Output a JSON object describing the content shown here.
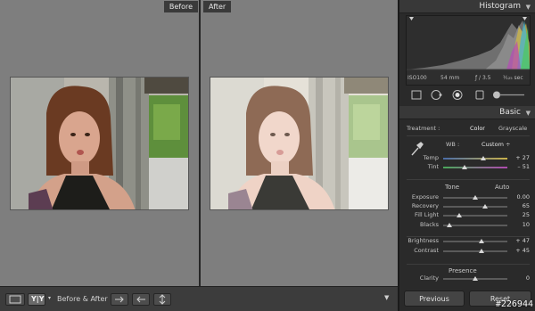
{
  "compare": {
    "before_label": "Before",
    "after_label": "After"
  },
  "toolbar": {
    "before_after_label": "Before & After :",
    "view_yy_label": "Y|Y"
  },
  "panel": {
    "histogram_title": "Histogram",
    "iso": "ISO100",
    "focal": "54 mm",
    "aperture": "ƒ / 3.5",
    "shutter": "¹⁄₁₂₅ sec",
    "basic_title": "Basic",
    "treatment_label": "Treatment :",
    "treatment_color": "Color",
    "treatment_grayscale": "Grayscale",
    "wb_label": "WB :",
    "wb_value": "Custom ÷",
    "tone_label": "Tone",
    "tone_auto": "Auto",
    "presence_label": "Presence",
    "previous_button": "Previous",
    "reset_button": "Reset"
  },
  "sliders": [
    {
      "label": "Temp",
      "value": "+ 27",
      "level": 0.62
    },
    {
      "label": "Tint",
      "value": "– 51",
      "level": 0.34
    },
    {
      "label": "Exposure",
      "value": "0.00",
      "level": 0.5
    },
    {
      "label": "Recovery",
      "value": "65",
      "level": 0.65
    },
    {
      "label": "Fill Light",
      "value": "25",
      "level": 0.25
    },
    {
      "label": "Blacks",
      "value": "10",
      "level": 0.1
    },
    {
      "label": "Brightness",
      "value": "+ 47",
      "level": 0.6
    },
    {
      "label": "Contrast",
      "value": "+ 45",
      "level": 0.6
    },
    {
      "label": "Clarity",
      "value": "0",
      "level": 0.5
    }
  ],
  "watermark": "#226944",
  "colors": {
    "panel_bg": "#2a2a2a",
    "canvas_bg": "#7e7e7e",
    "accent_knob": "#d8d8d8"
  }
}
